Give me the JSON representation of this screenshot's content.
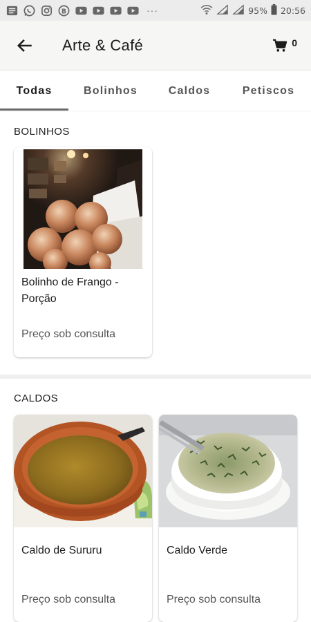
{
  "status_bar": {
    "battery": "95%",
    "time": "20:56",
    "overflow": "···"
  },
  "app_bar": {
    "title": "Arte & Café",
    "cart_count": "0"
  },
  "tabs": [
    {
      "label": "Todas",
      "active": true
    },
    {
      "label": "Bolinhos",
      "active": false
    },
    {
      "label": "Caldos",
      "active": false
    },
    {
      "label": "Petiscos",
      "active": false
    }
  ],
  "sections": [
    {
      "title": "BOLINHOS",
      "items": [
        {
          "name": "Bolinho de Frango - Porção",
          "price": "Preço sob consulta"
        }
      ]
    },
    {
      "title": "CALDOS",
      "items": [
        {
          "name": "Caldo de Sururu",
          "price": "Preço sob consulta"
        },
        {
          "name": "Caldo Verde",
          "price": "Preço sob consulta"
        }
      ]
    }
  ],
  "colors": {
    "status_bar_bg": "#ececec",
    "app_bar_bg": "#f6f6f4",
    "tab_indicator": "#6a6a6a"
  }
}
